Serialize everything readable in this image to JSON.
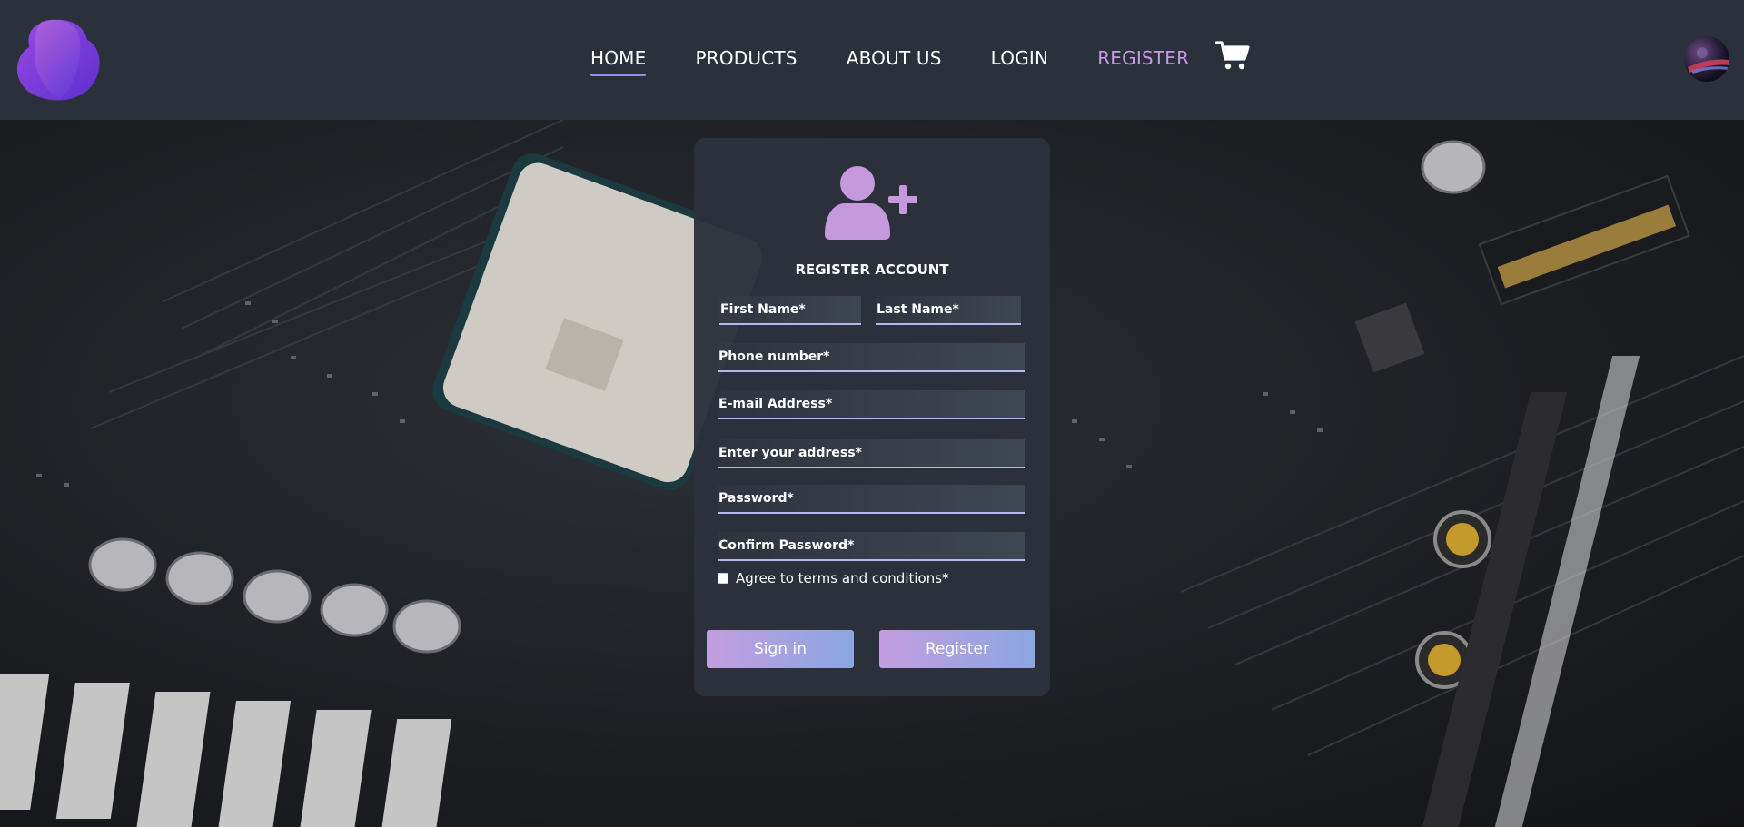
{
  "nav": {
    "links": [
      {
        "label": "HOME"
      },
      {
        "label": "PRODUCTS"
      },
      {
        "label": "ABOUT US"
      },
      {
        "label": "LOGIN"
      },
      {
        "label": "REGISTER"
      }
    ],
    "active_color": "#9b8be8",
    "accent_color": "#c69be6"
  },
  "icons": {
    "logo": "logo-blob",
    "cart": "cart-icon",
    "avatar": "avatar",
    "register": "user-plus-icon"
  },
  "form": {
    "title": "REGISTER ACCOUNT",
    "first_name": "First Name*",
    "last_name": "Last Name*",
    "phone": "Phone number*",
    "email": "E-mail Address*",
    "address": "Enter your address*",
    "password": "Password*",
    "confirm_password": "Confirm Password*",
    "agree_label": "Agree to terms and conditions*",
    "signin_label": "Sign in",
    "register_label": "Register",
    "accent_color": "#c39ddf"
  }
}
